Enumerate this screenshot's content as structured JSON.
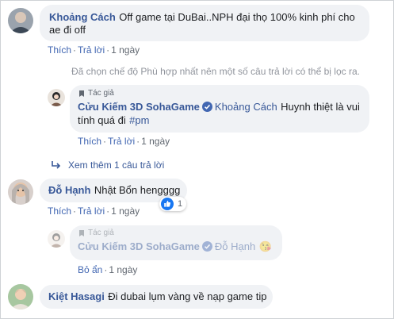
{
  "comments": [
    {
      "author": "Khoảng Cách",
      "text_line1": "Off game tại DuBai..NPH đại thọ 100% kinh phí cho",
      "text_line2": "ae đi off",
      "actions": [
        "Thích",
        "Trả lời",
        "1 ngày"
      ]
    },
    {
      "author": "Đỗ Hạnh",
      "text": "Nhật Bổn hengggg",
      "actions": [
        "Thích",
        "Trả lời",
        "1 ngày"
      ],
      "reaction_count": "1"
    },
    {
      "author": "Kiệt Hasagi",
      "text": "Đi dubai lụm vàng về nạp game tip"
    }
  ],
  "filter_notice": "Đã chọn chế độ Phù hợp nhất nên một số câu trả lời có thể bị lọc ra.",
  "replies": [
    {
      "badge": "Tác giả",
      "author": "Cửu Kiếm 3D SohaGame",
      "mention": "Khoảng Cách",
      "text_line1": "Huynh thiệt là vui",
      "text_line2": "tính quá đi",
      "hashtag": "#pm",
      "actions": [
        "Thích",
        "Trả lời",
        "1 ngày"
      ]
    },
    {
      "badge": "Tác giả",
      "author": "Cửu Kiếm 3D SohaGame",
      "mention": "Đỗ Hạnh",
      "emoji": "😘",
      "actions": [
        "Bỏ ẩn",
        "1 ngày"
      ]
    }
  ],
  "more_replies": "Xem thêm 1 câu trả lời",
  "colors": {
    "link": "#385898",
    "action": "#4267b2",
    "bubble": "#f0f2f5",
    "verified": "#4267b2",
    "like": "#1877f2"
  },
  "icons": [
    "verified-badge-icon",
    "reply-arrow-icon",
    "like-reaction-icon",
    "author-badge-icon",
    "kiss-emoji-icon"
  ]
}
